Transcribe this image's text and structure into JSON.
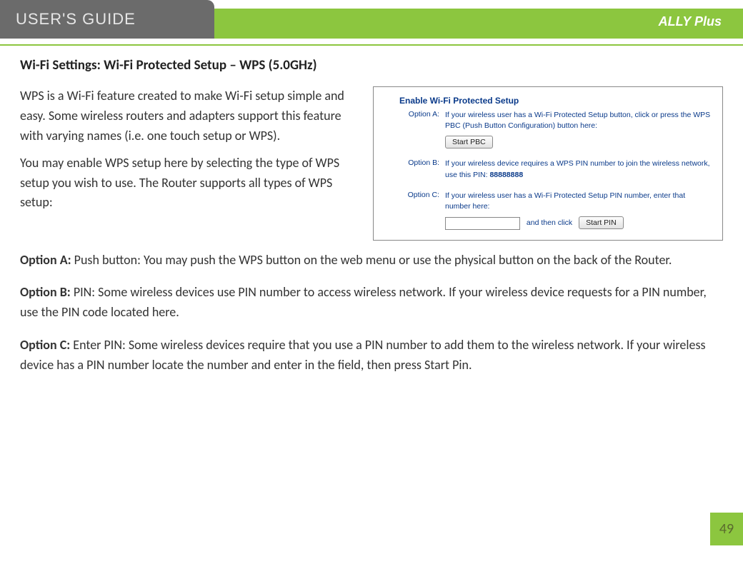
{
  "header": {
    "guide_label": "USER'S GUIDE",
    "brand": "ALLY Plus"
  },
  "section_title": "Wi-Fi Settings: Wi-Fi Protected Setup – WPS (5.0GHz)",
  "intro": {
    "p1": "WPS is a Wi-Fi feature created to make Wi-Fi setup simple and easy.  Some wireless routers and adapters support this feature with varying names (i.e. one touch setup or WPS).",
    "p2": "You may enable WPS setup here by selecting the type of WPS setup you wish to use. The Router supports all types of WPS setup:"
  },
  "screenshot": {
    "title": "Enable Wi-Fi Protected Setup",
    "optionA": {
      "label": "Option A:",
      "desc": "If your wireless user has a Wi-Fi Protected Setup button, click or press the WPS PBC (Push Button Configuration) button here:",
      "button": "Start PBC"
    },
    "optionB": {
      "label": "Option B:",
      "desc": "If your wireless device requires a WPS PIN number to join the wireless network, use this PIN: ",
      "pin": "88888888"
    },
    "optionC": {
      "label": "Option C:",
      "desc": "If your wireless user has a Wi-Fi Protected Setup PIN number, enter that number here:",
      "and_then": "and then click",
      "button": "Start PIN",
      "input_value": ""
    }
  },
  "options": {
    "a": {
      "lead": "Option A: ",
      "text": "Push button: You may push the WPS button on the web menu or use the physical button on the back of the Router."
    },
    "b": {
      "lead": "Option B: ",
      "text": "PIN: Some wireless devices use PIN number to access wireless network.  If your wireless device requests for a PIN number, use the PIN code located here."
    },
    "c": {
      "lead": "Option C: ",
      "text": "Enter PIN: Some wireless devices require that you use a PIN number to add them to the wireless network.  If your wireless device has a PIN number locate the number and enter in the field, then press Start Pin."
    }
  },
  "page_number": "49"
}
